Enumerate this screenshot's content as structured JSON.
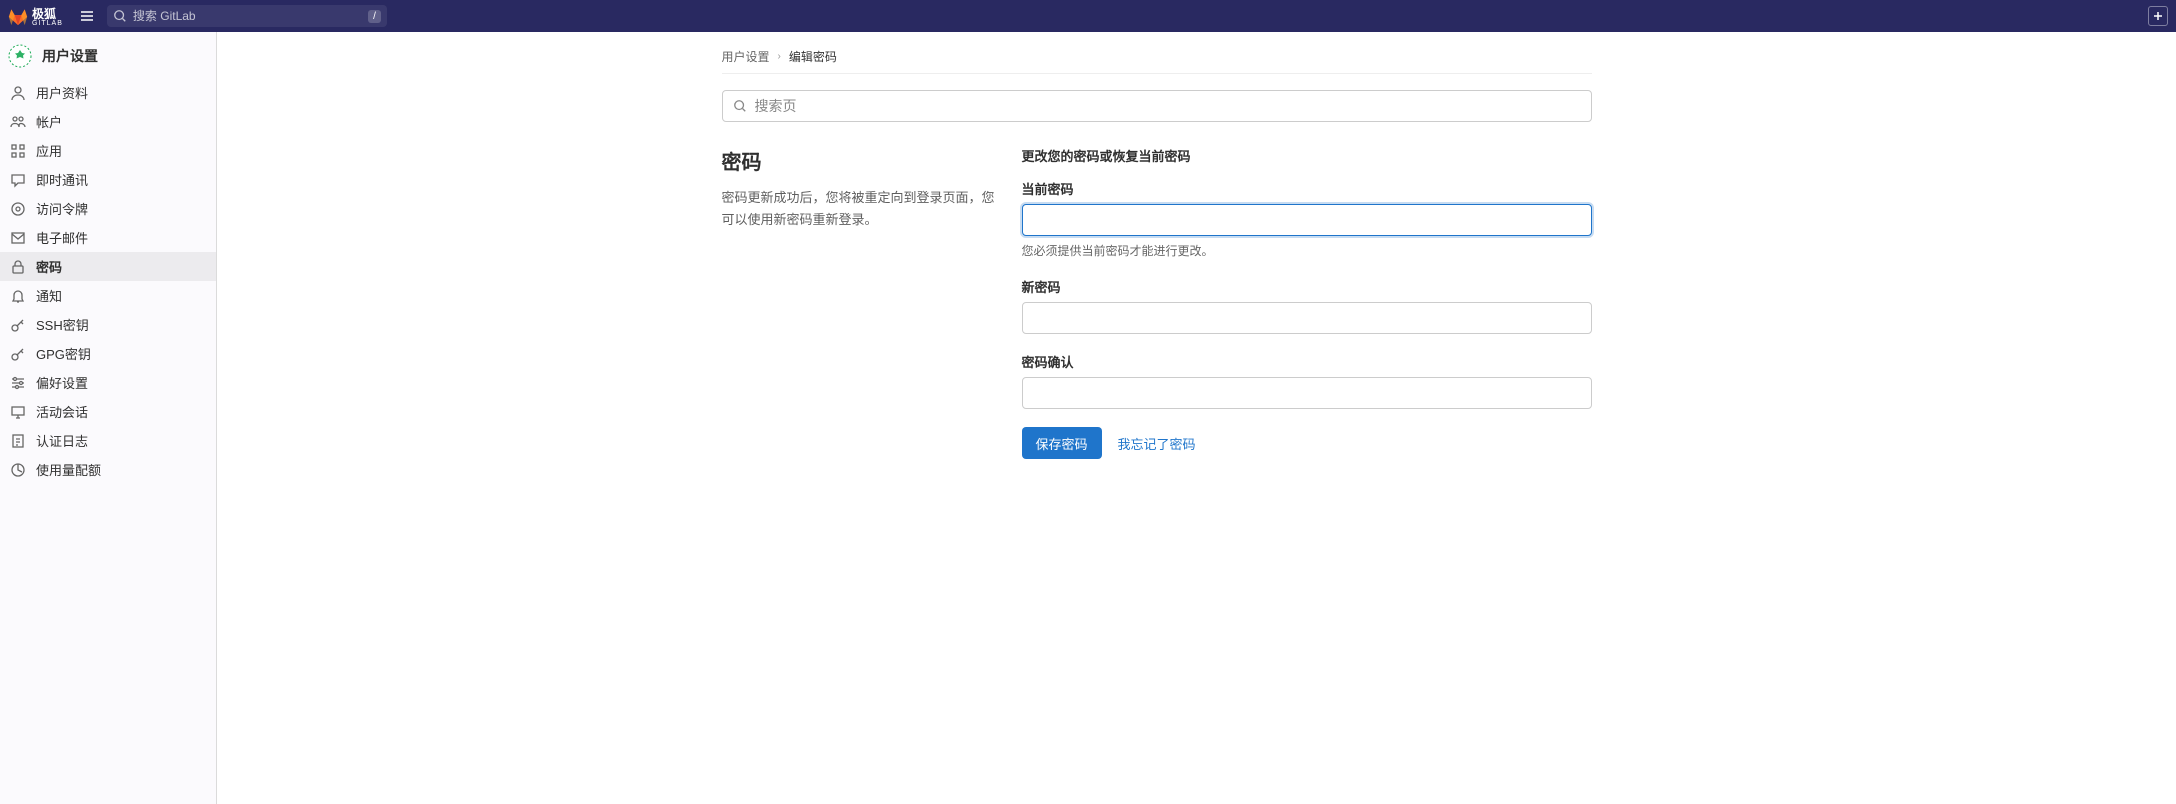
{
  "navbar": {
    "brand_main": "极狐",
    "brand_sub": "GITLAB",
    "search_placeholder": "搜索 GitLab",
    "shortcut_key": "/"
  },
  "sidebar": {
    "header": "用户设置",
    "items": [
      {
        "label": "用户资料",
        "icon": "user-icon"
      },
      {
        "label": "帐户",
        "icon": "account-icon"
      },
      {
        "label": "应用",
        "icon": "applications-icon"
      },
      {
        "label": "即时通讯",
        "icon": "chat-icon"
      },
      {
        "label": "访问令牌",
        "icon": "token-icon"
      },
      {
        "label": "电子邮件",
        "icon": "email-icon"
      },
      {
        "label": "密码",
        "icon": "lock-icon",
        "active": true
      },
      {
        "label": "通知",
        "icon": "bell-icon"
      },
      {
        "label": "SSH密钥",
        "icon": "key-icon"
      },
      {
        "label": "GPG密钥",
        "icon": "key-icon"
      },
      {
        "label": "偏好设置",
        "icon": "preferences-icon"
      },
      {
        "label": "活动会话",
        "icon": "monitor-icon"
      },
      {
        "label": "认证日志",
        "icon": "log-icon"
      },
      {
        "label": "使用量配额",
        "icon": "quota-icon"
      }
    ]
  },
  "breadcrumb": {
    "root": "用户设置",
    "current": "编辑密码"
  },
  "page_search": {
    "placeholder": "搜索页"
  },
  "main": {
    "heading": "密码",
    "description": "密码更新成功后，您将被重定向到登录页面，您可以使用新密码重新登录。",
    "subtitle": "更改您的密码或恢复当前密码",
    "fields": {
      "current_password": {
        "label": "当前密码",
        "help": "您必须提供当前密码才能进行更改。"
      },
      "new_password": {
        "label": "新密码"
      },
      "confirm_password": {
        "label": "密码确认"
      }
    },
    "save_button": "保存密码",
    "forgot_link": "我忘记了密码"
  }
}
